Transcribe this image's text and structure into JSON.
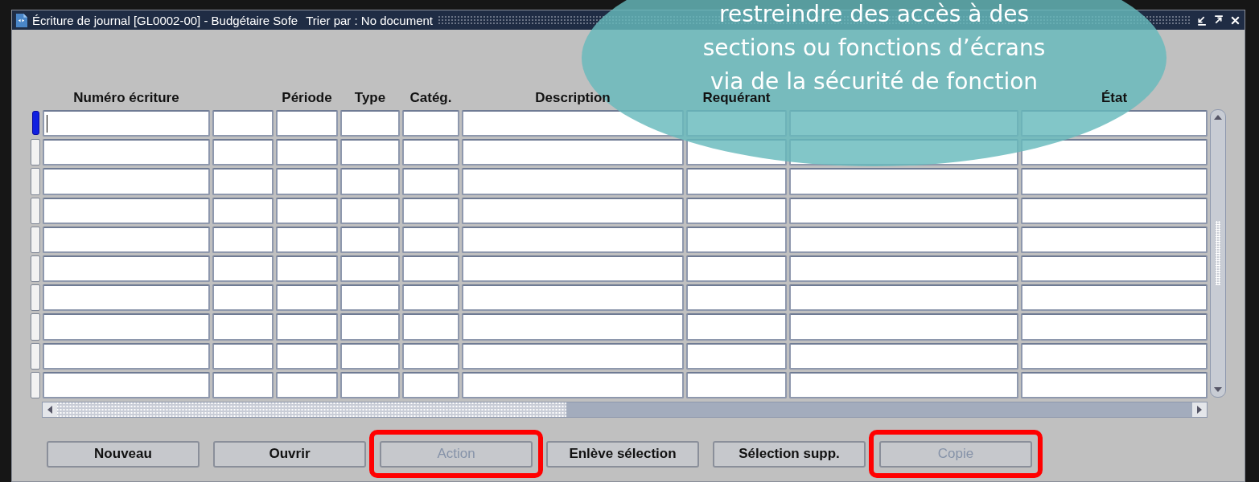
{
  "window": {
    "title": "Écriture de journal [GL0002-00] - Budgétaire Sofe",
    "sort_label": "Trier par : No document"
  },
  "table": {
    "columns": [
      {
        "label": "Numéro écriture"
      },
      {},
      {
        "label": "Période"
      },
      {
        "label": "Type"
      },
      {
        "label": "Catég."
      },
      {
        "label": "Description"
      },
      {
        "label": "Requérant"
      },
      {},
      {
        "label": "État"
      }
    ],
    "rows": [
      {
        "current": true
      },
      {
        "current": false
      },
      {
        "current": false
      },
      {
        "current": false
      },
      {
        "current": false
      },
      {
        "current": false
      },
      {
        "current": false
      },
      {
        "current": false
      },
      {
        "current": false
      },
      {
        "current": false
      }
    ]
  },
  "buttons": [
    {
      "label": "Nouveau",
      "disabled": false,
      "highlighted": false
    },
    {
      "label": "Ouvrir",
      "disabled": false,
      "highlighted": false
    },
    {
      "label": "Action",
      "disabled": true,
      "highlighted": true
    },
    {
      "label": "Enlève sélection",
      "disabled": false,
      "highlighted": false
    },
    {
      "label": "Sélection supp.",
      "disabled": false,
      "highlighted": false
    },
    {
      "label": "Copie",
      "disabled": true,
      "highlighted": true
    }
  ],
  "callout": {
    "lines": [
      "restreindre des accès à des",
      "sections ou fonctions d’écrans",
      "via de la sécurité de fonction"
    ]
  }
}
